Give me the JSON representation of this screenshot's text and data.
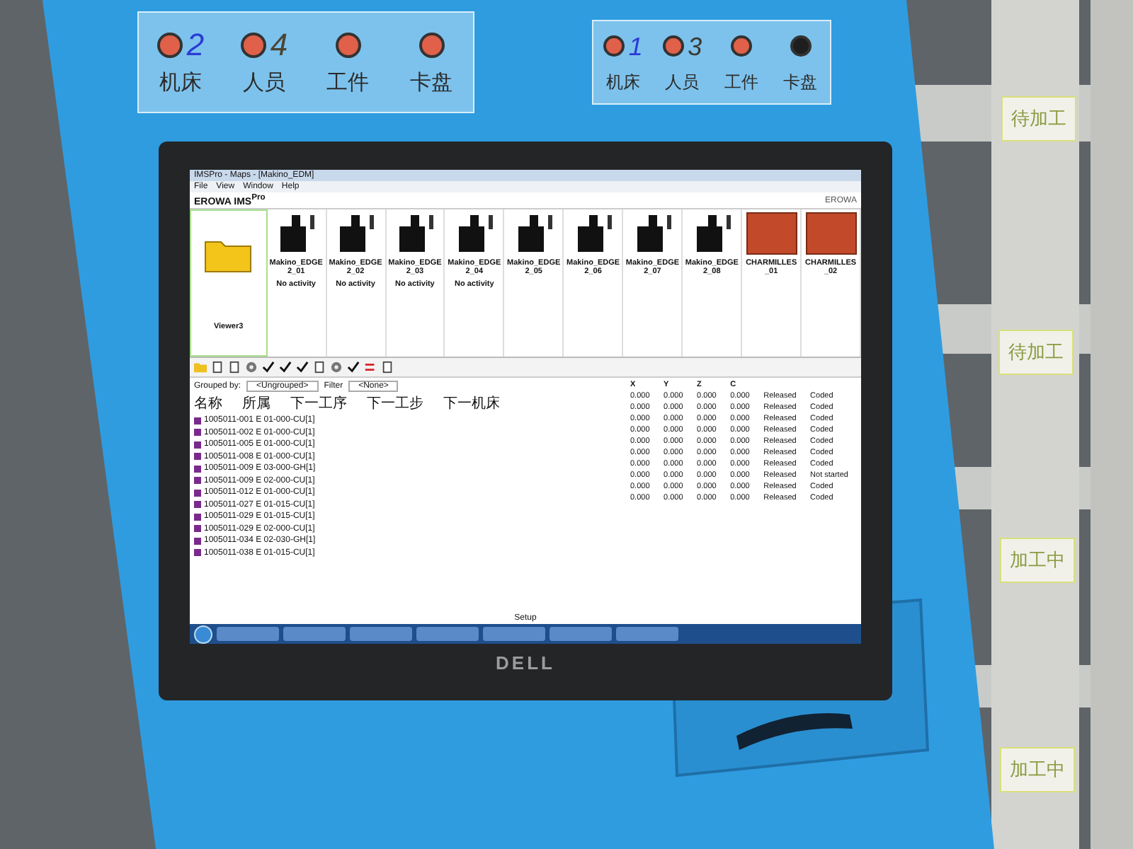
{
  "control_panels": [
    {
      "indicators": [
        {
          "label": "机床",
          "lit": true,
          "note": "2",
          "color": "#2a3bd6"
        },
        {
          "label": "人员",
          "lit": true,
          "note": "4",
          "color": "#4a4636"
        },
        {
          "label": "工件",
          "lit": true
        },
        {
          "label": "卡盘",
          "lit": true
        }
      ]
    },
    {
      "indicators": [
        {
          "label": "机床",
          "lit": true,
          "note": "1",
          "color": "#2a3bd6"
        },
        {
          "label": "人员",
          "lit": true,
          "note": "3",
          "color": "#3a3830"
        },
        {
          "label": "工件",
          "lit": true
        },
        {
          "label": "卡盘",
          "lit": false
        }
      ]
    }
  ],
  "monitor": {
    "brand": "DELL",
    "screen": {
      "window_title": "IMSPro - Maps - [Makino_EDM]",
      "menu": [
        "File",
        "View",
        "Window",
        "Help"
      ],
      "brand": "EROWA IMS$^{Pro}$",
      "logo": "EROWA",
      "tiles": [
        {
          "kind": "folder",
          "name": "Viewer3"
        },
        {
          "kind": "machine",
          "name": "Makino_EDGE2_01",
          "status": "No activity"
        },
        {
          "kind": "machine",
          "name": "Makino_EDGE2_02",
          "status": "No activity"
        },
        {
          "kind": "machine",
          "name": "Makino_EDGE2_03",
          "status": "No activity"
        },
        {
          "kind": "machine",
          "name": "Makino_EDGE2_04",
          "status": "No activity"
        },
        {
          "kind": "machine",
          "name": "Makino_EDGE2_05"
        },
        {
          "kind": "machine",
          "name": "Makino_EDGE2_06"
        },
        {
          "kind": "machine",
          "name": "Makino_EDGE2_07"
        },
        {
          "kind": "machine",
          "name": "Makino_EDGE2_08"
        },
        {
          "kind": "photo",
          "name": "CHARMILLES_01"
        },
        {
          "kind": "photo",
          "name": "CHARMILLES_02"
        }
      ],
      "list": {
        "grouped_by_label": "Grouped by:",
        "group": "<Ungrouped>",
        "filter_label": "Filter",
        "filter": "<None>",
        "name_header": "名称",
        "columns": [
          "所属",
          "下一工序",
          "下一工步",
          "下一机床"
        ],
        "rows": [
          "1005011-001 E 01-000-CU[1]",
          "1005011-002 E 01-000-CU[1]",
          "1005011-005 E 01-000-CU[1]",
          "1005011-008 E 01-000-CU[1]",
          "1005011-009 E 03-000-GH[1]",
          "1005011-009 E 02-000-CU[1]",
          "1005011-012 E 01-000-CU[1]",
          "1005011-027 E 01-015-CU[1]",
          "1005011-029 E 01-015-CU[1]",
          "1005011-029 E 02-000-CU[1]",
          "1005011-034 E 02-030-GH[1]",
          "1005011-038 E 01-015-CU[1]"
        ]
      },
      "values": {
        "columns": [
          "X",
          "Y",
          "Z",
          "C"
        ],
        "rows": [
          {
            "values": [
              "0.000",
              "0.000",
              "0.000",
              "0.000"
            ],
            "status": "Released",
            "code": "Coded"
          },
          {
            "values": [
              "0.000",
              "0.000",
              "0.000",
              "0.000"
            ],
            "status": "Released",
            "code": "Coded"
          },
          {
            "values": [
              "0.000",
              "0.000",
              "0.000",
              "0.000"
            ],
            "status": "Released",
            "code": "Coded"
          },
          {
            "values": [
              "0.000",
              "0.000",
              "0.000",
              "0.000"
            ],
            "status": "Released",
            "code": "Coded"
          },
          {
            "values": [
              "0.000",
              "0.000",
              "0.000",
              "0.000"
            ],
            "status": "Released",
            "code": "Coded"
          },
          {
            "values": [
              "0.000",
              "0.000",
              "0.000",
              "0.000"
            ],
            "status": "Released",
            "code": "Coded"
          },
          {
            "values": [
              "0.000",
              "0.000",
              "0.000",
              "0.000"
            ],
            "status": "Released",
            "code": "Coded"
          },
          {
            "values": [
              "0.000",
              "0.000",
              "0.000",
              "0.000"
            ],
            "status": "Released",
            "code": "Not started"
          },
          {
            "values": [
              "0.000",
              "0.000",
              "0.000",
              "0.000"
            ],
            "status": "Released",
            "code": "Coded"
          },
          {
            "values": [
              "0.000",
              "0.000",
              "0.000",
              "0.000"
            ],
            "status": "Released",
            "code": "Coded"
          }
        ]
      },
      "footer_label": "Setup"
    }
  },
  "shelf_labels": [
    "待加工",
    "待加工",
    "加工中",
    "加工中"
  ]
}
